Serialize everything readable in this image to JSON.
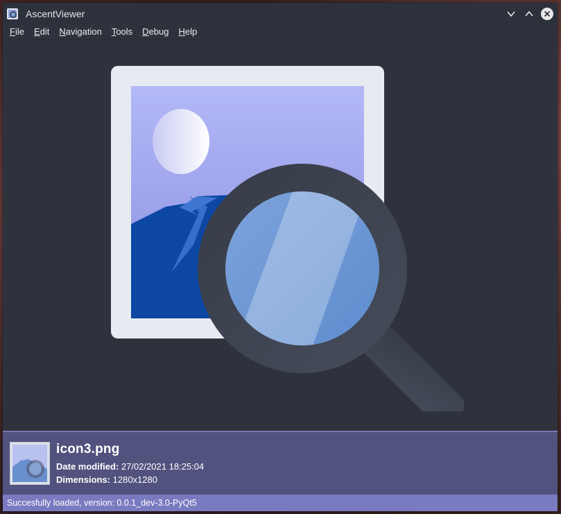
{
  "window": {
    "title": "AscentViewer"
  },
  "menubar": {
    "items": [
      {
        "label_mnemonic": "F",
        "label_rest": "ile"
      },
      {
        "label_mnemonic": "E",
        "label_rest": "dit"
      },
      {
        "label_mnemonic": "N",
        "label_rest": "avigation"
      },
      {
        "label_mnemonic": "T",
        "label_rest": "ools"
      },
      {
        "label_mnemonic": "D",
        "label_rest": "ebug"
      },
      {
        "label_mnemonic": "H",
        "label_rest": "elp"
      }
    ]
  },
  "icons": {
    "app": "app-logo-icon",
    "minimize": "chevron-down-icon",
    "maximize": "chevron-up-icon",
    "close": "close-icon",
    "preview": "image-viewer-magnifier-icon"
  },
  "info": {
    "file_name": "icon3.png",
    "date_label": "Date modified:",
    "date_value": "27/02/2021 18:25:04",
    "dim_label": "Dimensions:",
    "dim_value": "1280x1280"
  },
  "status": {
    "text": "Succesfully loaded, version: 0.0.1_dev-3.0-PyQt5"
  },
  "colors": {
    "window_bg": "#2e323c",
    "info_panel": "#52527f",
    "status_bar": "#7a7ac0",
    "accent": "#7a7ab7"
  }
}
